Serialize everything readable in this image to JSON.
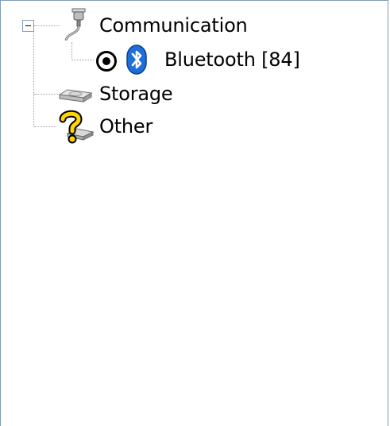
{
  "tree": {
    "items": [
      {
        "label": "Communication",
        "icon": "connector-plug-icon",
        "expanded": true,
        "children": [
          {
            "label": "Bluetooth [84]",
            "icons": [
              "radio-selected-icon",
              "bluetooth-icon"
            ]
          }
        ]
      },
      {
        "label": "Storage",
        "icon": "storage-drive-icon"
      },
      {
        "label": "Other",
        "icon": "unknown-device-icon"
      }
    ]
  },
  "colors": {
    "border": "#7f9db9",
    "tree_lines": "#a0a0a0",
    "bluetooth": "#1f6fd8",
    "question_yellow": "#ffd400"
  }
}
